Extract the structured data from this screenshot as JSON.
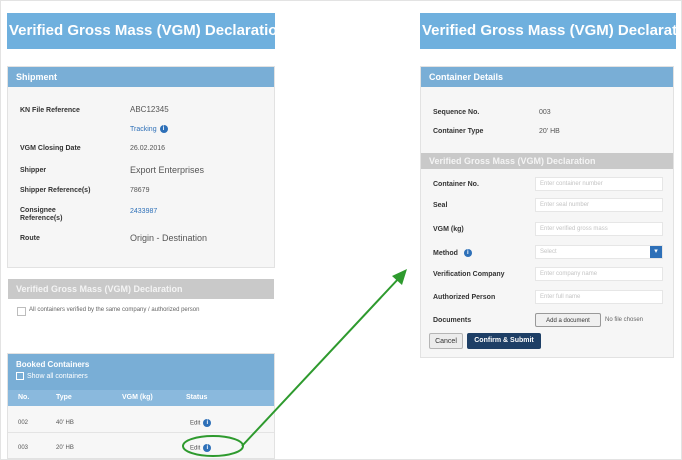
{
  "left": {
    "title": "Verified Gross Mass (VGM) Declaration",
    "shipment": {
      "section": "Shipment",
      "rows": [
        {
          "label": "KN File Reference",
          "value": "ABC12345"
        },
        {
          "label": "VGM Closing Date",
          "value": "26.02.2016"
        },
        {
          "label": "Shipper",
          "value": "Export Enterprises"
        },
        {
          "label": "Shipper Reference(s)",
          "value": "78679"
        },
        {
          "label": "Consignee Reference(s)",
          "value": "2433987"
        },
        {
          "label": "Route",
          "value": "Origin - Destination"
        }
      ],
      "tracking": "Tracking"
    },
    "vgm_section": "Verified Gross Mass (VGM) Declaration",
    "checkbox_label": "All containers verified by the same company / authorized person",
    "booked": {
      "title": "Booked Containers",
      "show_all": "Show all containers",
      "columns": [
        "No.",
        "Type",
        "VGM (kg)",
        "Status"
      ],
      "rows": [
        {
          "no": "002",
          "type": "40' HB",
          "vgm": "",
          "status": "Edit"
        },
        {
          "no": "003",
          "type": "20' HB",
          "vgm": "",
          "status": "Edit"
        }
      ]
    }
  },
  "right": {
    "title": "Verified Gross Mass (VGM) Declaration",
    "container": {
      "section": "Container Details",
      "sequence_label": "Sequence No.",
      "sequence_value": "003",
      "type_label": "Container Type",
      "type_value": "20' HB"
    },
    "vgm_section": "Verified Gross Mass (VGM) Declaration",
    "fields": [
      {
        "label": "Container No.",
        "placeholder": "Enter container number"
      },
      {
        "label": "Seal",
        "placeholder": "Enter seal number"
      },
      {
        "label": "VGM (kg)",
        "placeholder": "Enter verified gross mass"
      },
      {
        "label": "Method",
        "placeholder": "Select"
      },
      {
        "label": "Verification Company",
        "placeholder": "Enter company name"
      },
      {
        "label": "Authorized Person",
        "placeholder": "Enter full name"
      }
    ],
    "documents_label": "Documents",
    "add_files": "Add a document",
    "no_file": "No file chosen",
    "cancel": "Cancel",
    "confirm": "Confirm & Submit"
  },
  "colors": {
    "header": "#6fb0de",
    "bar": "#79aed6",
    "link": "#2e70b8",
    "arrow": "#2e9a2e",
    "submit": "#1e3f66"
  }
}
